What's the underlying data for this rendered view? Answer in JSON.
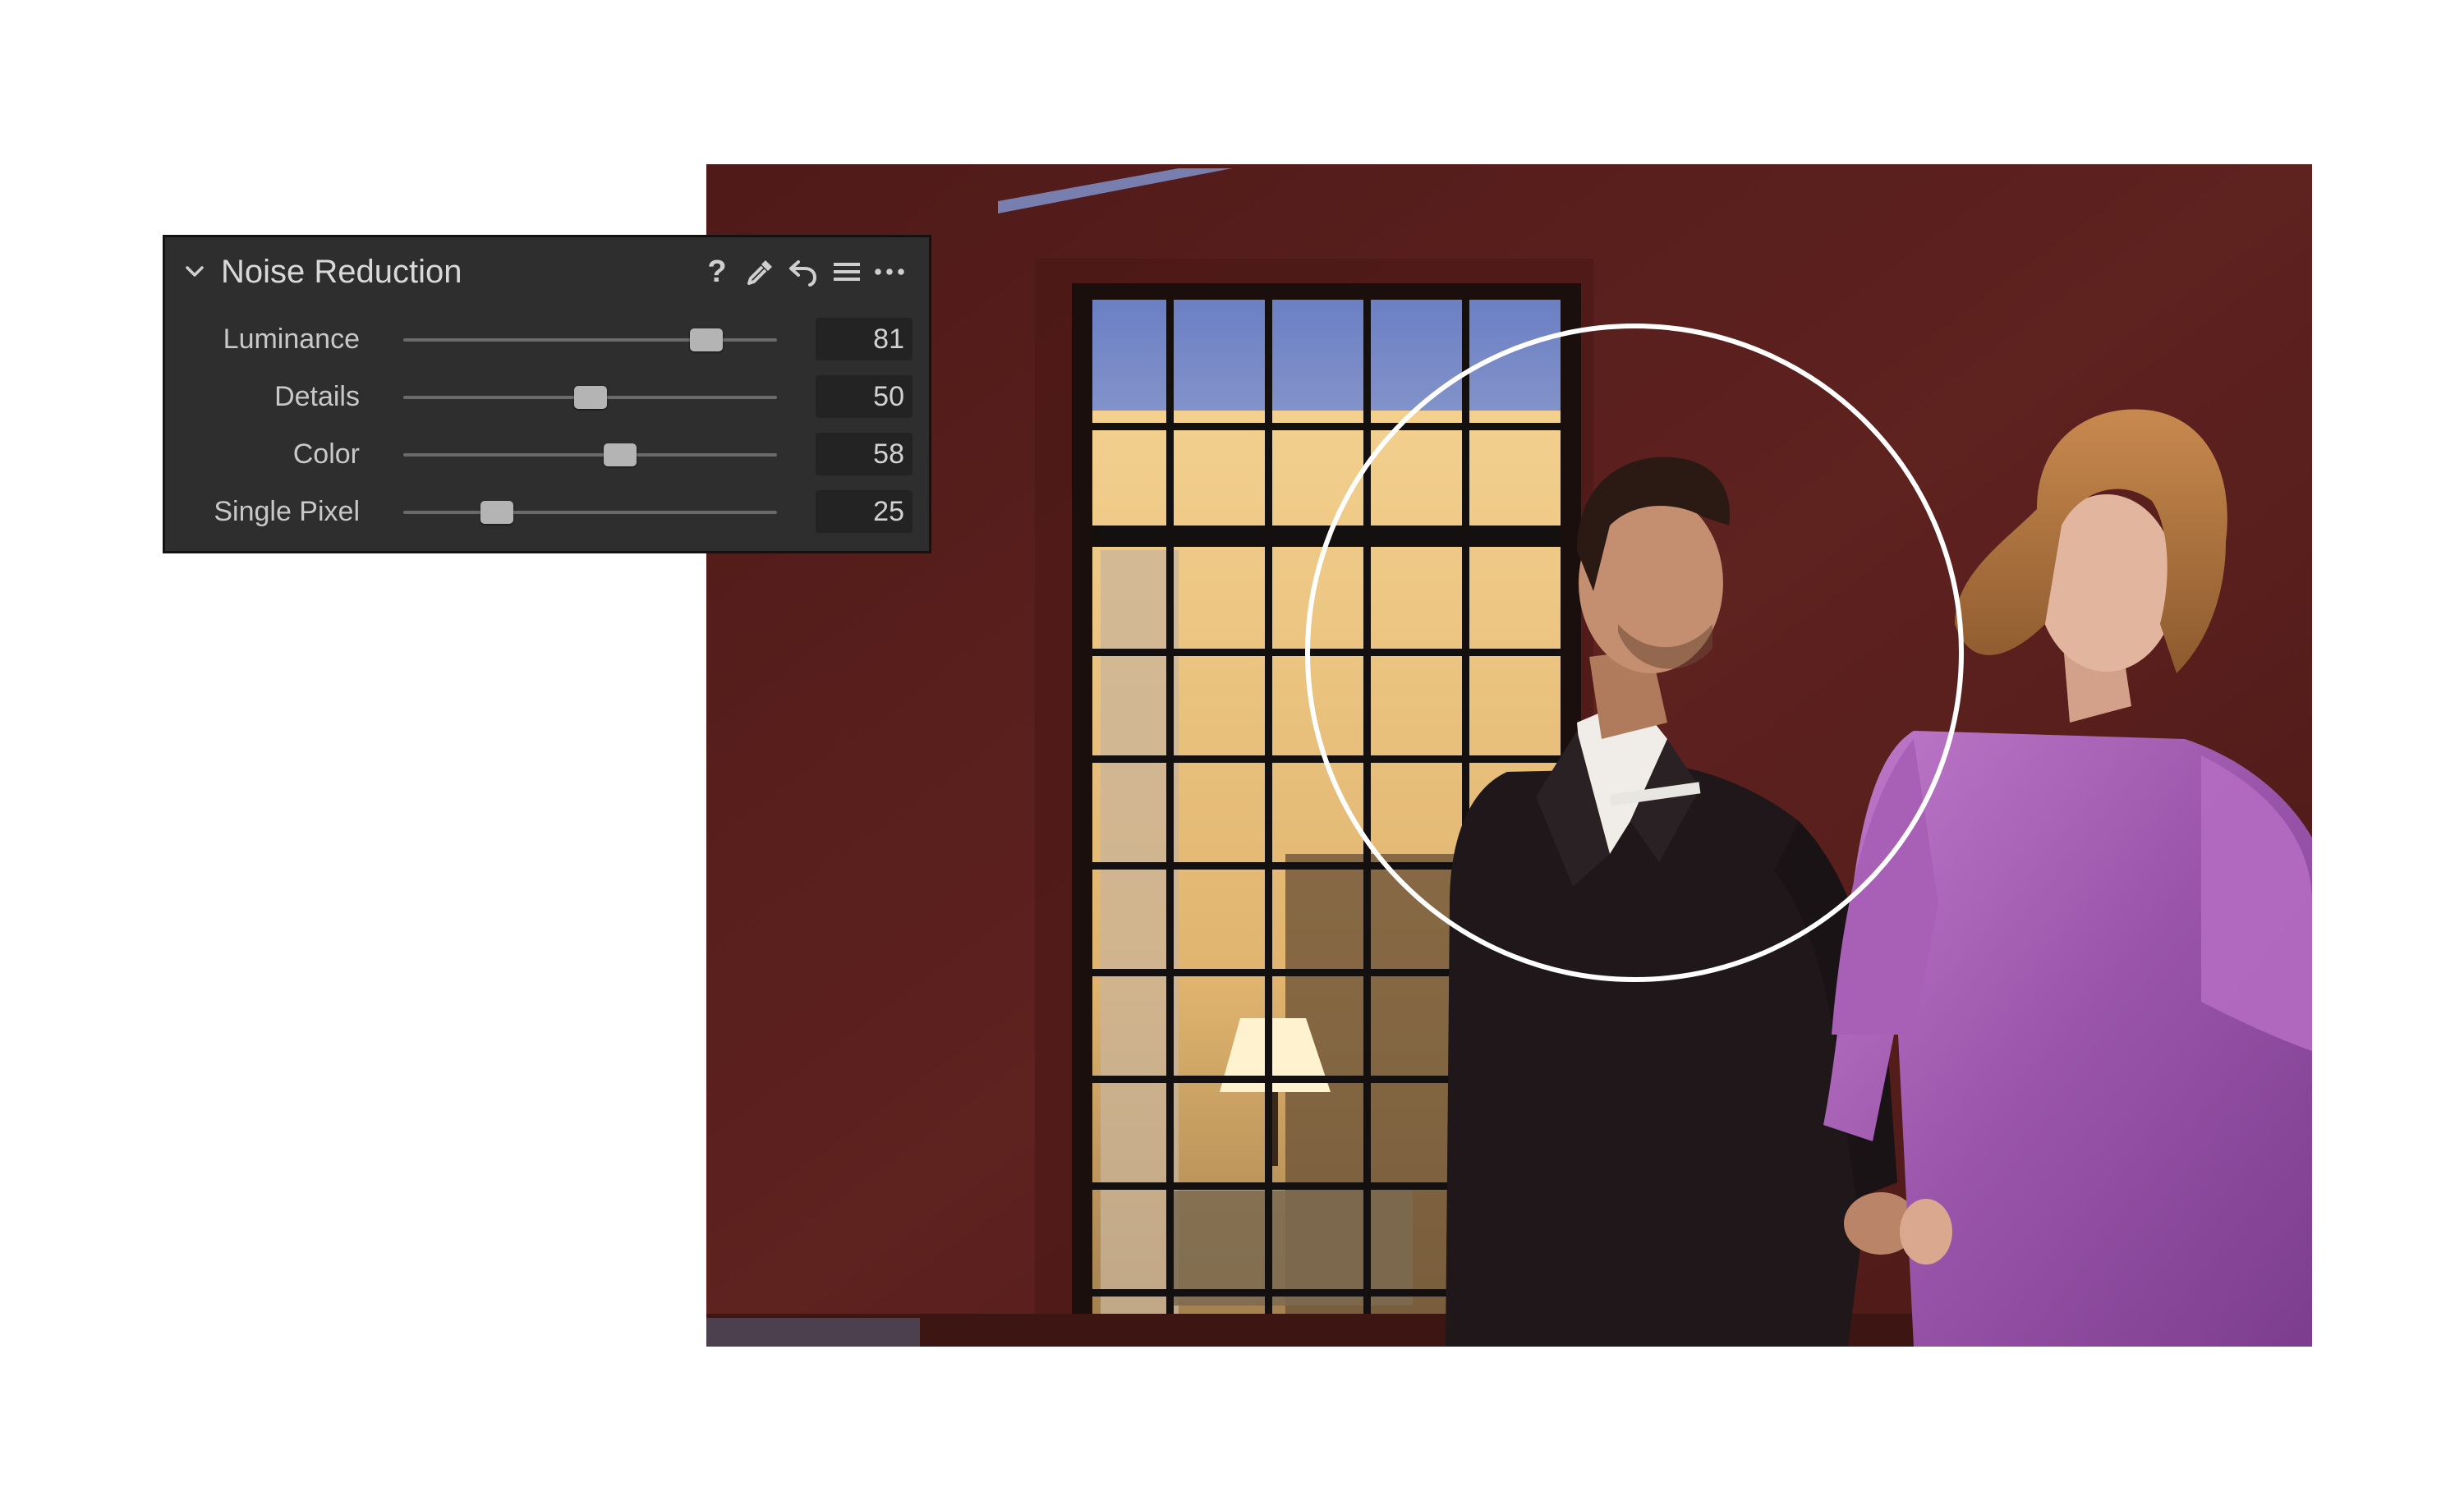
{
  "panel": {
    "title": "Noise Reduction",
    "icons": [
      "chevron-down-icon",
      "help-icon",
      "picker-icon",
      "reset-icon",
      "presets-icon",
      "more-icon"
    ],
    "help_glyph": "?",
    "sliders": [
      {
        "label": "Luminance",
        "value": "81",
        "fraction": 0.81
      },
      {
        "label": "Details",
        "value": "50",
        "fraction": 0.5
      },
      {
        "label": "Color",
        "value": "58",
        "fraction": 0.58
      },
      {
        "label": "Single Pixel",
        "value": "25",
        "fraction": 0.25
      }
    ]
  },
  "colors": {
    "panel_bg": "#2e2e2e",
    "wall": "#5a201d",
    "window_light": "#f0c77a",
    "dress": "#a35cb0",
    "suit": "#1e1718",
    "loupe_circle": "#ffffff"
  }
}
